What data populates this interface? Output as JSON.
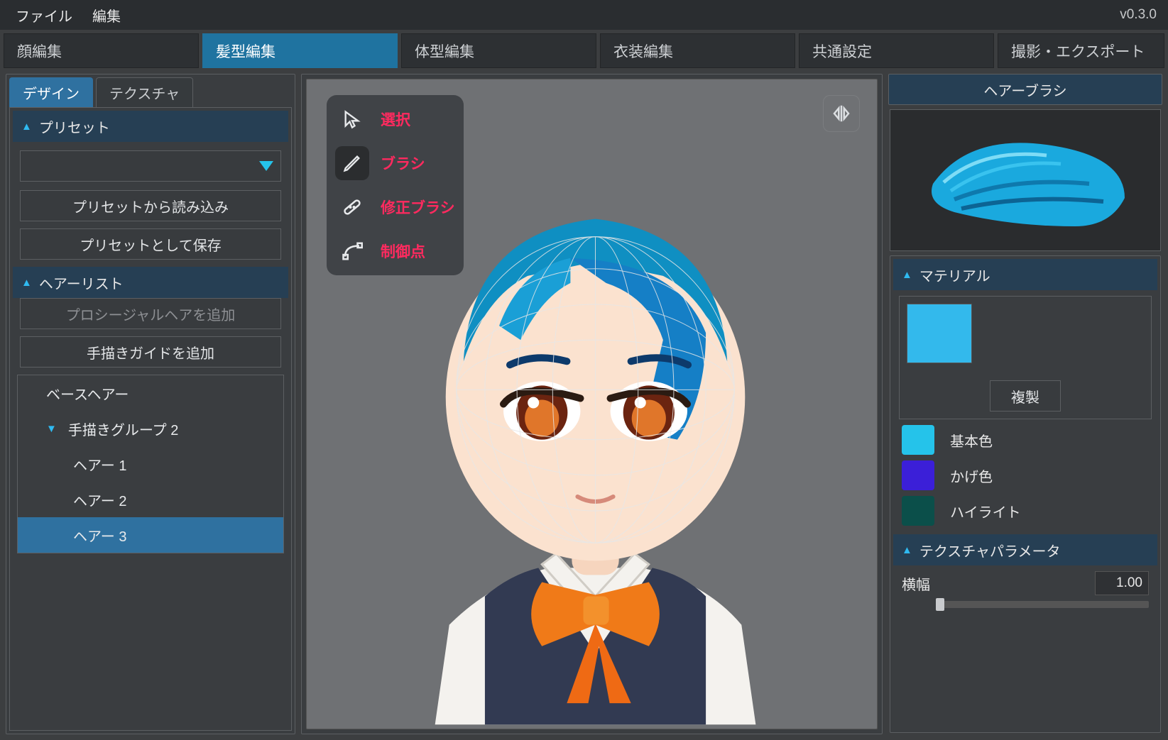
{
  "version": "v0.3.0",
  "menu": {
    "file": "ファイル",
    "edit": "編集"
  },
  "mainTabs": [
    "顔編集",
    "髪型編集",
    "体型編集",
    "衣装編集",
    "共通設定",
    "撮影・エクスポート"
  ],
  "mainTabActive": 1,
  "leftSubTabs": [
    "デザイン",
    "テクスチャ"
  ],
  "leftSubActive": 0,
  "preset": {
    "header": "プリセット",
    "load": "プリセットから読み込み",
    "save": "プリセットとして保存"
  },
  "hairList": {
    "header": "ヘアーリスト",
    "addProcedural": "プロシージャルヘアを追加",
    "addGuide": "手描きガイドを追加",
    "items": [
      {
        "label": "ベースヘアー",
        "indent": 1
      },
      {
        "label": "手描きグループ 2",
        "indent": 1,
        "exp": true
      },
      {
        "label": "ヘアー 1",
        "indent": 2
      },
      {
        "label": "ヘアー 2",
        "indent": 2
      },
      {
        "label": "ヘアー 3",
        "indent": 2,
        "sel": true
      }
    ]
  },
  "tools": {
    "select": "選択",
    "brush": "ブラシ",
    "fix": "修正ブラシ",
    "control": "制御点"
  },
  "right": {
    "title": "ヘアーブラシ",
    "materialHeader": "マテリアル",
    "dup": "複製",
    "colors": [
      {
        "label": "基本色",
        "hex": "#25c3ea"
      },
      {
        "label": "かげ色",
        "hex": "#3b1fd8"
      },
      {
        "label": "ハイライト",
        "hex": "#0b4f4a"
      }
    ],
    "texParamHeader": "テクスチャパラメータ",
    "param": {
      "label": "横幅",
      "value": "1.00"
    }
  }
}
